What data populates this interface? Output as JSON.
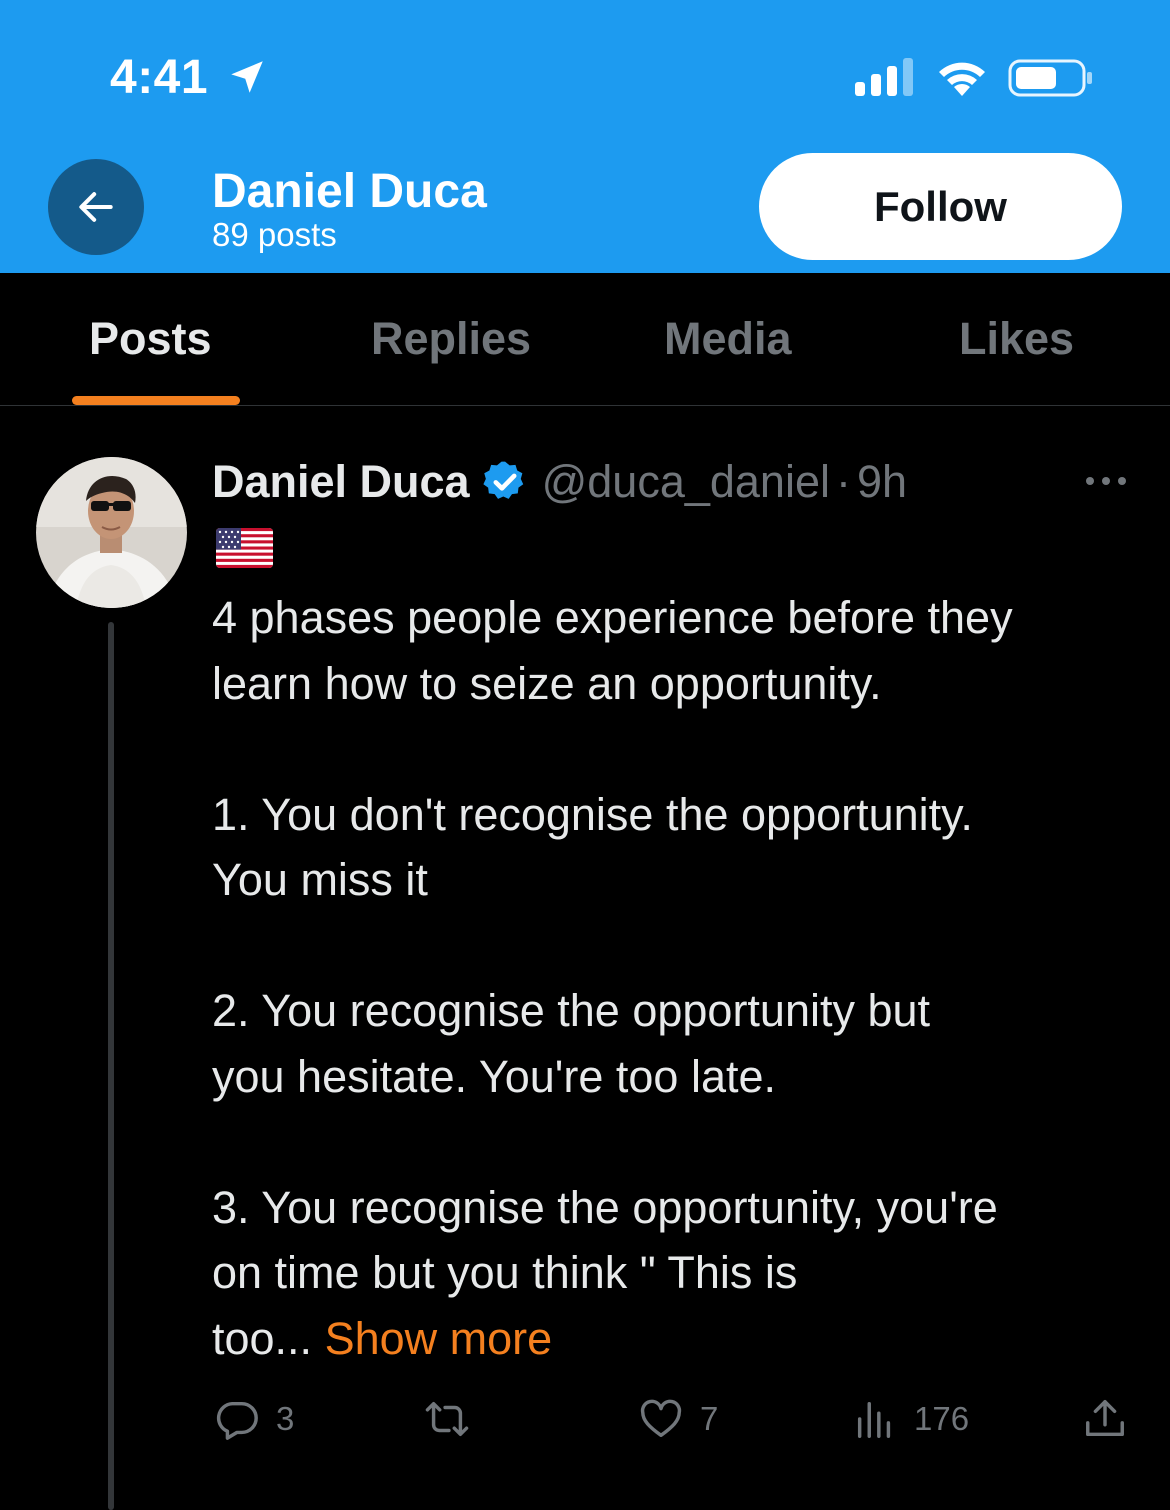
{
  "status_bar": {
    "time": "4:41"
  },
  "header": {
    "name": "Daniel Duca",
    "post_count": "89 posts",
    "follow_label": "Follow",
    "colors": {
      "background": "#1d9bf0",
      "back_button": "#145a8a"
    }
  },
  "tabs": [
    {
      "label": "Posts",
      "active": true
    },
    {
      "label": "Replies",
      "active": false
    },
    {
      "label": "Media",
      "active": false
    },
    {
      "label": "Likes",
      "active": false
    }
  ],
  "accent_color": "#f4801f",
  "post": {
    "author_name": "Daniel Duca",
    "verified": true,
    "handle": "@duca_daniel",
    "separator": "·",
    "time": "9h",
    "flag": "us-flag-icon",
    "lines": [
      "4 phases people experience before they",
      "learn how to seize an opportunity.",
      "",
      "1. You don't recognise the opportunity.",
      "You miss it",
      "",
      "2. You recognise the opportunity but",
      "you hesitate. You're too late.",
      "",
      "3. You recognise the opportunity, you're",
      "on time but you think \" This is"
    ],
    "truncated_tail": "too...",
    "show_more": "Show more",
    "actions": {
      "replies": "3",
      "reposts": "",
      "likes": "7",
      "views": "176"
    }
  }
}
